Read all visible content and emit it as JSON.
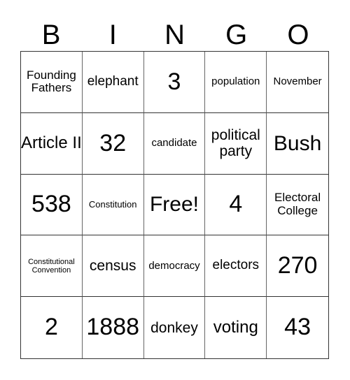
{
  "header": {
    "letters": [
      "B",
      "I",
      "N",
      "G",
      "O"
    ]
  },
  "cells": [
    "Founding Fathers",
    "elephant",
    "3",
    "population",
    "November",
    "Article II",
    "32",
    "candidate",
    "political party",
    "Bush",
    "538",
    "Constitution",
    "Free!",
    "4",
    "Electoral College",
    "Constitutional Convention",
    "census",
    "democracy",
    "electors",
    "270",
    "2",
    "1888",
    "donkey",
    "voting",
    "43"
  ]
}
